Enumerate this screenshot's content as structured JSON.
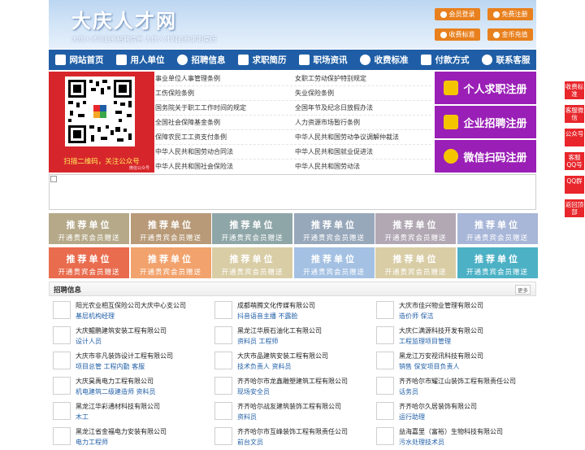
{
  "header": {
    "logo_text": "大庆人才网",
    "slogan": "大庆人才网最新招聘信息   大庆人才网最新求职简历",
    "buttons": [
      {
        "label": "会员登录"
      },
      {
        "label": "免费注册"
      },
      {
        "label": "收费标准"
      },
      {
        "label": "金币充值"
      }
    ]
  },
  "nav": {
    "items": [
      {
        "label": "网站首页",
        "icon": "home-icon"
      },
      {
        "label": "用人单位",
        "icon": "building-icon"
      },
      {
        "label": "招聘信息",
        "icon": "person-icon"
      },
      {
        "label": "求职简历",
        "icon": "key-icon"
      },
      {
        "label": "职场资讯",
        "icon": "news-icon"
      },
      {
        "label": "收费标准",
        "icon": "fee-icon"
      },
      {
        "label": "付款方式",
        "icon": "card-icon"
      },
      {
        "label": "联系客服",
        "icon": "phone-icon"
      }
    ]
  },
  "qr": {
    "caption": "扫描二维码，关注公众号",
    "sub": "微信公众号"
  },
  "links": [
    "事业单位人事管理条例",
    "女职工劳动保护特别规定",
    "工伤保险条例",
    "失业保险条例",
    "国务院关于职工工作时间的规定",
    "全国年节及纪念日放假办法",
    "全国社会保障基金条例",
    "人力资源市场暂行条例",
    "保障农民工工资支付条例",
    "中华人民共和国劳动争议调解仲裁法",
    "中华人民共和国劳动合同法",
    "中华人民共和国就业促进法",
    "中华人民共和国社会保险法",
    "中华人民共和国劳动法"
  ],
  "register": [
    {
      "label": "个人求职注册"
    },
    {
      "label": "企业招聘注册"
    },
    {
      "label": "微信扫码注册"
    }
  ],
  "recommend": {
    "title": "推荐单位",
    "subtitle": "开通贵宾会员赠送",
    "colors": [
      "#b5a989",
      "#b89a78",
      "#8fa6a8",
      "#98a8bb",
      "#b2a8b4",
      "#a8b6d8",
      "#e96c4e",
      "#f2a26c",
      "#d9cda6",
      "#a4c1e3",
      "#d9cda6",
      "#4cb1c5"
    ]
  },
  "jobs": {
    "title": "招聘信息",
    "more": "更多",
    "items": [
      {
        "company": "阳光农业相互保险公司大庆中心支公司",
        "positions": "基层机构经理"
      },
      {
        "company": "成都萌腾文化传媒有限公司",
        "positions": "抖音语音主播 不露脸"
      },
      {
        "company": "大庆市佳兴物业管理有限公司",
        "positions": "造价师 保洁"
      },
      {
        "company": "大庆鲲鹏建筑安装工程有限公司",
        "positions": "设计人员"
      },
      {
        "company": "黑龙江华辰石油化工有限公司",
        "positions": "资料员 工程师"
      },
      {
        "company": "大庆仁满源科技开发有限公司",
        "positions": "工程监理项目管理"
      },
      {
        "company": "大庆市非凡装饰设计工程有限公司",
        "positions": "项目总管 工程内勤 客服"
      },
      {
        "company": "大庆市品建筑安装工程有限公司",
        "positions": "技术负责人 资料员"
      },
      {
        "company": "黑龙江万安视讯科技有限公司",
        "positions": "销售 保安项目负责人"
      },
      {
        "company": "大庆昊禹电力工程有限公司",
        "positions": "机电建筑二级建造师 资料员"
      },
      {
        "company": "齐齐哈尔市龙鑫雕塑建筑工程有限公司",
        "positions": "现场安全员"
      },
      {
        "company": "齐齐哈尔市耀江山装饰工程有限责任公司",
        "positions": "话务员"
      },
      {
        "company": "黑龙江华彩通材科技有限公司",
        "positions": "木工"
      },
      {
        "company": "齐齐哈尔战友建筑装饰工程有限公司",
        "positions": "资料员"
      },
      {
        "company": "齐齐哈尔久居装饰有限公司",
        "positions": "运行助理"
      },
      {
        "company": "黑龙江省金福电力安装有限公司",
        "positions": "电力工程师"
      },
      {
        "company": "齐齐哈尔市互峰装饰工程有限责任公司",
        "positions": "前台文员"
      },
      {
        "company": "益海嘉里（富裕）生物科技有限公司",
        "positions": "污水处理技术员"
      }
    ]
  },
  "side_tabs": [
    {
      "label": "收费标准"
    },
    {
      "label": "客服微信"
    },
    {
      "label": "公众号"
    },
    {
      "label": "客服QQ号"
    },
    {
      "label": "QQ群"
    },
    {
      "label": "返回顶部"
    }
  ]
}
